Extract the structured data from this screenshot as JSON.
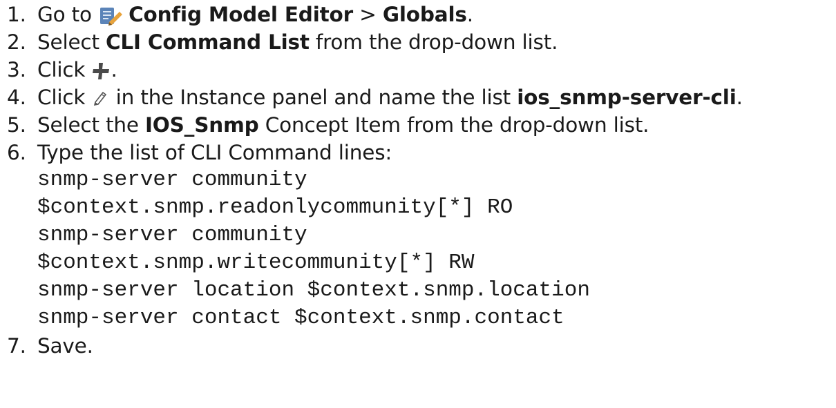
{
  "steps": [
    {
      "number": "1.",
      "prefix": "Go to ",
      "icon": "config-model-editor-icon",
      "bold1": "Config Model Editor",
      "middle": " > ",
      "bold2": "Globals",
      "suffix": "."
    },
    {
      "number": "2.",
      "prefix": "Select ",
      "bold": "CLI Command List",
      "suffix": " from the drop-down list."
    },
    {
      "number": "3.",
      "prefix": "Click ",
      "icon": "add-plus-icon",
      "suffix": "."
    },
    {
      "number": "4.",
      "prefix": "Click ",
      "icon": "edit-pencil-icon",
      "middle": " in the Instance panel and name the list ",
      "bold": "ios_snmp-server-cli",
      "suffix": "."
    },
    {
      "number": "5.",
      "prefix": "Select the ",
      "bold": "IOS_Snmp",
      "suffix": " Concept Item from the drop-down list."
    },
    {
      "number": "6.",
      "text": "Type the list of CLI Command lines:"
    },
    {
      "number": "7.",
      "text": "Save."
    }
  ],
  "code_lines": [
    "snmp-server community",
    "$context.snmp.readonlycommunity[*] RO",
    "snmp-server community",
    "$context.snmp.writecommunity[*] RW",
    "snmp-server location $context.snmp.location",
    "snmp-server contact $context.snmp.contact"
  ],
  "colors": {
    "text": "#1a1a1a",
    "icon_blue": "#5b84b8",
    "icon_gray": "#4a4a4a",
    "icon_orange": "#e8a33c"
  }
}
